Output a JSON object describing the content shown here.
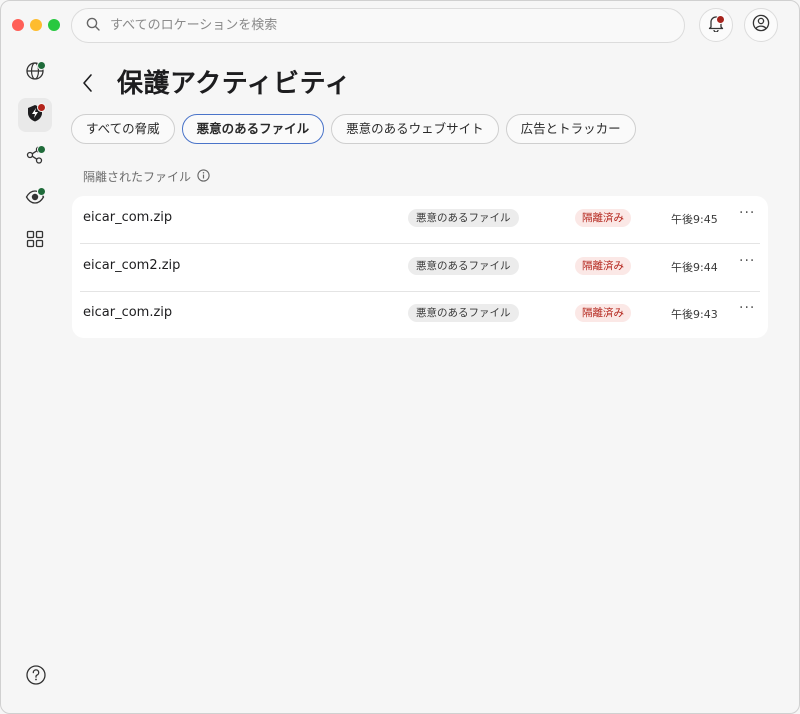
{
  "search": {
    "placeholder": "すべてのロケーションを検索"
  },
  "page": {
    "title": "保護アクティビティ"
  },
  "tabs": [
    {
      "label": "すべての脅威"
    },
    {
      "label": "悪意のあるファイル"
    },
    {
      "label": "悪意のあるウェブサイト"
    },
    {
      "label": "広告とトラッカー"
    }
  ],
  "section": {
    "label": "隔離されたファイル"
  },
  "rows": [
    {
      "name": "eicar_com.zip",
      "type": "悪意のあるファイル",
      "status": "隔離済み",
      "time": "午後9:45",
      "more": "···"
    },
    {
      "name": "eicar_com2.zip",
      "type": "悪意のあるファイル",
      "status": "隔離済み",
      "time": "午後9:44",
      "more": "···"
    },
    {
      "name": "eicar_com.zip",
      "type": "悪意のあるファイル",
      "status": "隔離済み",
      "time": "午後9:43",
      "more": "···"
    }
  ],
  "colors": {
    "active_tab_border": "#4a74c9",
    "status_red": "#b3231a",
    "badge_green": "#1f6b3a"
  }
}
